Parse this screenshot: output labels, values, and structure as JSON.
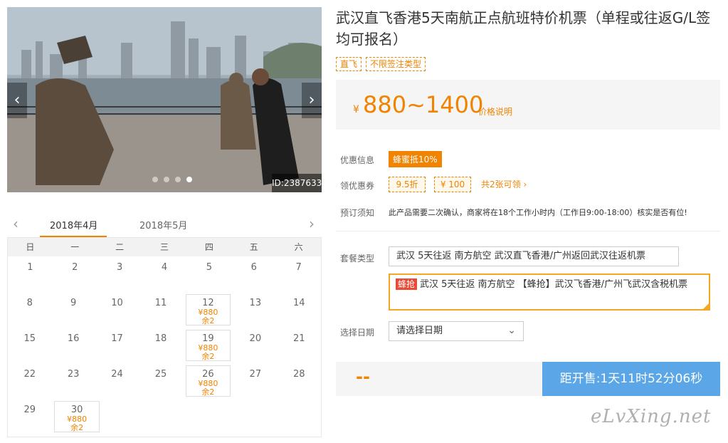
{
  "gallery": {
    "image_id": "ID:2387633",
    "prev_icon": "‹",
    "next_icon": "›",
    "dot_count": 4,
    "active_dot": 3
  },
  "calendar": {
    "prev_icon": "‹",
    "next_icon": "›",
    "months": [
      "2018年4月",
      "2018年5月"
    ],
    "active_month": "2018年4月",
    "weekdays": [
      "日",
      "一",
      "二",
      "三",
      "四",
      "五",
      "六"
    ],
    "weeks": [
      [
        {
          "d": "1"
        },
        {
          "d": "2"
        },
        {
          "d": "3"
        },
        {
          "d": "4"
        },
        {
          "d": "5"
        },
        {
          "d": "6"
        },
        {
          "d": "7"
        }
      ],
      [
        {
          "d": "8"
        },
        {
          "d": "9"
        },
        {
          "d": "10"
        },
        {
          "d": "11"
        },
        {
          "d": "12",
          "price": "¥880",
          "rem": "余2"
        },
        {
          "d": "13"
        },
        {
          "d": "14"
        }
      ],
      [
        {
          "d": "15"
        },
        {
          "d": "16"
        },
        {
          "d": "17"
        },
        {
          "d": "18"
        },
        {
          "d": "19",
          "price": "¥880",
          "rem": "余2"
        },
        {
          "d": "20"
        },
        {
          "d": "21"
        }
      ],
      [
        {
          "d": "22"
        },
        {
          "d": "23"
        },
        {
          "d": "24"
        },
        {
          "d": "25"
        },
        {
          "d": "26",
          "price": "¥880",
          "rem": "余2"
        },
        {
          "d": "27"
        },
        {
          "d": "28"
        }
      ],
      [
        {
          "d": "29"
        },
        {
          "d": "30",
          "price": "¥880",
          "rem": "余2"
        },
        {
          "d": ""
        },
        {
          "d": ""
        },
        {
          "d": ""
        },
        {
          "d": ""
        },
        {
          "d": ""
        }
      ]
    ]
  },
  "product": {
    "title": "武汉直飞香港5天南航正点航班特价机票（单程或往返G/L签均可报名）",
    "tags": [
      "直飞",
      "不限签注类型"
    ],
    "price_symbol": "¥",
    "price": "880~1400",
    "price_note": "价格说明",
    "promo_label": "优惠信息",
    "promo_badge": "蜂蜜抵10%",
    "coupon_label": "领优惠券",
    "coupons": [
      "9.5折",
      "¥ 100"
    ],
    "coupon_more": "共2张可领 ›",
    "notice_label": "预订须知",
    "notice_text": "此产品需要二次确认，商家将在18个工作小时内（工作日9:00-18:00）核实是否有位!",
    "package_label": "套餐类型",
    "package_1": "武汉 5天往返 南方航空 武汉直飞香港/广州返回武汉往返机票",
    "package_2_badge": "蜂抢",
    "package_2": "武汉 5天往返 南方航空 【蜂抢】武汉飞香港/广州飞武汉含税机票",
    "date_label": "选择日期",
    "date_placeholder": "请选择日期",
    "date_chevron": "⌄",
    "bottom_price": "--",
    "countdown": "距开售:1天11时52分06秒",
    "watermark": "eLvXing.net"
  },
  "colors": {
    "accent": "#f08300",
    "button_blue": "#5aa6e6",
    "badge_red": "#e94a35"
  }
}
